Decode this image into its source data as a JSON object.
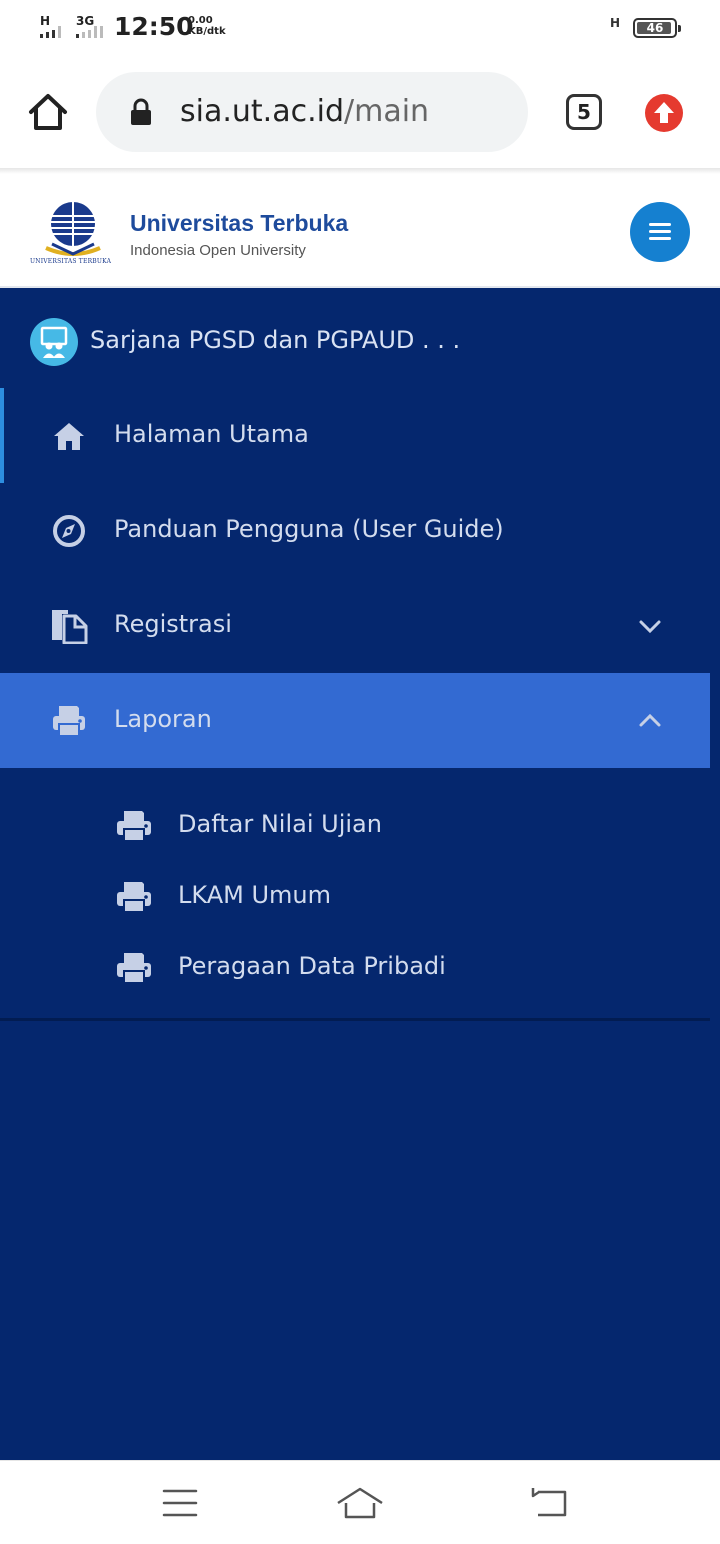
{
  "status_bar": {
    "signal1_label": "H",
    "signal2_label": "3G",
    "time": "12:50",
    "speed_value": "0.00",
    "speed_unit": "KB/dtk",
    "signal3_label": "H",
    "battery_level": "46"
  },
  "browser": {
    "url_host": "sia.ut.ac.id",
    "url_path": "/main",
    "tab_count": "5"
  },
  "site_header": {
    "brand_name": "Universitas Terbuka",
    "tagline": "Indonesia Open University",
    "logo_caption": "UNIVERSITAS TERBUKA",
    "accent_color": "#1580d0"
  },
  "sidebar": {
    "background_color": "#05276e",
    "profile_name": "Sarjana PGSD dan PGPAUD . . .",
    "items": [
      {
        "label": "Halaman Utama",
        "icon": "home-icon"
      },
      {
        "label": "Panduan Pengguna (User Guide)",
        "icon": "compass-icon"
      },
      {
        "label": "Registrasi",
        "icon": "documents-icon",
        "expandable": true,
        "expanded": false
      },
      {
        "label": "Laporan",
        "icon": "printer-icon",
        "expandable": true,
        "expanded": true,
        "selected": true
      }
    ],
    "laporan_subitems": [
      {
        "label": "Daftar Nilai Ujian",
        "icon": "printer-icon"
      },
      {
        "label": "LKAM Umum",
        "icon": "printer-icon"
      },
      {
        "label": "Peragaan Data Pribadi",
        "icon": "printer-icon"
      }
    ],
    "selected_color": "#336ad2"
  },
  "system_nav": {
    "buttons": [
      "menu-icon",
      "home-icon",
      "back-icon"
    ]
  }
}
